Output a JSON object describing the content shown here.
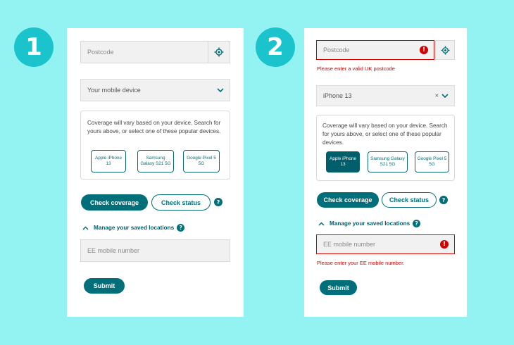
{
  "steps": [
    "1",
    "2"
  ],
  "panel1": {
    "postcode_placeholder": "Postcode",
    "device_placeholder": "Your mobile device",
    "coverage_text": "Coverage will vary based on your device. Search for yours above, or select one of these popular devices.",
    "devices": [
      "Apple iPhone 13",
      "Samsung Galaxy S21 5G",
      "Google Pixel 5 5G"
    ],
    "check_coverage": "Check coverage",
    "check_status": "Check status",
    "help": "?",
    "manage": "Manage your saved locations",
    "mobile_placeholder": "EE mobile number",
    "submit": "Submit"
  },
  "panel2": {
    "postcode_placeholder": "Postcode",
    "error_icon": "!",
    "postcode_error": "Please enter a valid UK postcode",
    "device_value": "iPhone 13",
    "clear_icon": "×",
    "coverage_text": "Coverage will vary based on your device. Search for yours above, or select one of these popular devices.",
    "devices": [
      "Apple iPhone 13",
      "Samsung Galaxy S21 5G",
      "Google Pixel 5 5G"
    ],
    "selected_device": "Apple iPhone 13",
    "check_coverage": "Check coverage",
    "check_status": "Check status",
    "help": "?",
    "manage": "Manage your saved locations",
    "mobile_placeholder": "EE mobile number",
    "mobile_error": "Please enter your EE mobile number.",
    "submit": "Submit"
  },
  "colors": {
    "background": "#93f3f3",
    "step_badge": "#1bc3cd",
    "brand_teal": "#006f7a",
    "error_red": "#d40000"
  },
  "icons": {
    "location": "crosshair-locate-icon",
    "chevron": "chevron-down-icon",
    "caret": "chevron-up-icon",
    "help": "question-circle-icon",
    "error": "error-alert-icon"
  }
}
